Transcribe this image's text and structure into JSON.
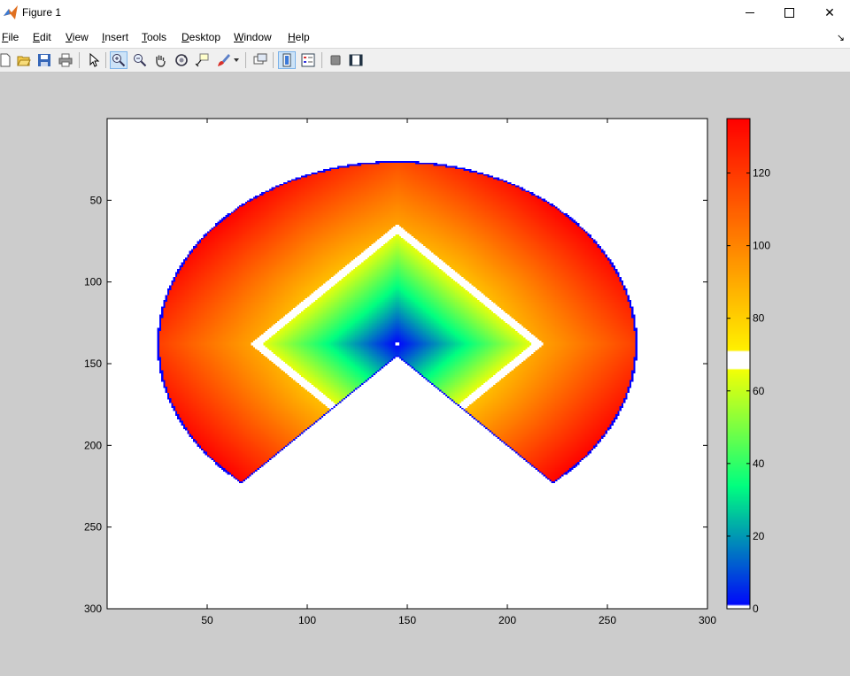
{
  "window": {
    "title": "Figure 1",
    "controls": {
      "minimize": "—",
      "maximize": "☐",
      "close": "✕"
    }
  },
  "menu": {
    "items": [
      {
        "label": "File",
        "mnemonic": "F"
      },
      {
        "label": "Edit",
        "mnemonic": "E"
      },
      {
        "label": "View",
        "mnemonic": "V"
      },
      {
        "label": "Insert",
        "mnemonic": "I"
      },
      {
        "label": "Tools",
        "mnemonic": "T"
      },
      {
        "label": "Desktop",
        "mnemonic": "D"
      },
      {
        "label": "Window",
        "mnemonic": "W"
      },
      {
        "label": "Help",
        "mnemonic": "H"
      }
    ],
    "dock_arrow": "↘"
  },
  "toolbar": {
    "buttons": [
      {
        "name": "new-figure-icon"
      },
      {
        "name": "open-file-icon"
      },
      {
        "name": "save-figure-icon"
      },
      {
        "name": "print-figure-icon"
      },
      {
        "name": "edit-plot-arrow-icon"
      },
      {
        "name": "zoom-in-icon",
        "active": true
      },
      {
        "name": "zoom-out-icon"
      },
      {
        "name": "pan-hand-icon"
      },
      {
        "name": "rotate-3d-icon"
      },
      {
        "name": "data-cursor-icon"
      },
      {
        "name": "brush-icon"
      },
      {
        "name": "link-plot-icon"
      },
      {
        "name": "insert-colorbar-icon",
        "active": true
      },
      {
        "name": "insert-legend-icon"
      },
      {
        "name": "hide-plot-tools-icon"
      },
      {
        "name": "show-plot-tools-icon"
      }
    ]
  },
  "chart_data": {
    "type": "heatmap",
    "title": "",
    "xlabel": "",
    "ylabel": "",
    "xlim": [
      0,
      300
    ],
    "ylim": [
      0,
      300
    ],
    "y_reversed": true,
    "x_ticks": [
      50,
      100,
      150,
      200,
      250,
      300
    ],
    "y_ticks": [
      50,
      100,
      150,
      200,
      250,
      300
    ],
    "image_size": [
      300,
      300
    ],
    "region": {
      "center": [
        145,
        138
      ],
      "outer_radius": 120,
      "outer_radius_y": 112,
      "wedge_apex": [
        145,
        146
      ],
      "wedge_half_angle_deg": 45,
      "inner_square_half_diagonal": 68,
      "inner_gap": 6,
      "boundary_color": "#0000ff"
    },
    "colorbar": {
      "range": [
        0,
        135
      ],
      "ticks": [
        0,
        20,
        40,
        60,
        80,
        100,
        120
      ],
      "white_bands": [
        [
          66,
          71
        ],
        [
          0,
          1
        ]
      ],
      "colors": [
        "#0000ff",
        "#00ff80",
        "#ffff00",
        "#ff8000",
        "#ff0000"
      ]
    }
  }
}
